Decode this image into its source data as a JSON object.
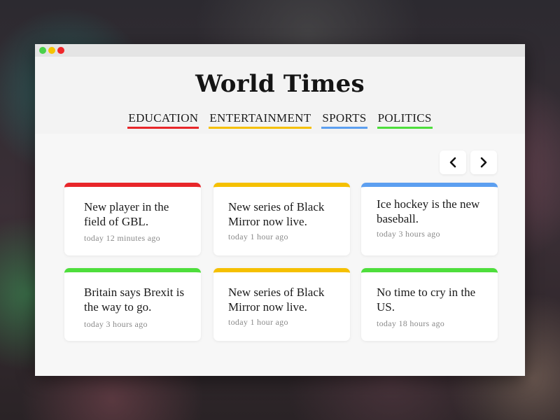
{
  "colors": {
    "education": "#e8262a",
    "entertainment": "#f5c000",
    "sports": "#5c9ff0",
    "politics": "#4ede3c"
  },
  "header": {
    "title": "World Times"
  },
  "nav": [
    {
      "label": "EDUCATION",
      "color_key": "education"
    },
    {
      "label": "ENTERTAINMENT",
      "color_key": "entertainment"
    },
    {
      "label": "SPORTS",
      "color_key": "sports"
    },
    {
      "label": "POLITICS",
      "color_key": "politics"
    }
  ],
  "carousel": {
    "prev_icon": "chevron-left-icon",
    "next_icon": "chevron-right-icon"
  },
  "articles": [
    {
      "headline": "New player in the field of GBL.",
      "time": "today 12 minutes ago",
      "color_key": "education"
    },
    {
      "headline": "New series of Black Mirror now live.",
      "time": "today 1 hour ago",
      "color_key": "entertainment"
    },
    {
      "headline": "Ice hockey is the new baseball.",
      "time": "today 3 hours ago",
      "color_key": "sports"
    },
    {
      "headline": "Britain says Brexit is the way to go.",
      "time": "today 3 hours ago",
      "color_key": "politics"
    },
    {
      "headline": "New series of Black Mirror now live.",
      "time": "today 1 hour ago",
      "color_key": "entertainment"
    },
    {
      "headline": "No time to cry in the US.",
      "time": "today 18 hours ago",
      "color_key": "politics"
    }
  ]
}
